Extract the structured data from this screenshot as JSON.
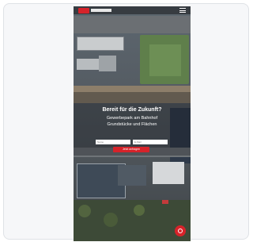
{
  "hero": {
    "headline": "Bereit für die Zukunft?",
    "subline_1": "Gewerbepark am Bahnhof",
    "subline_2": "Grundstücke und Flächen"
  },
  "form": {
    "field_1_placeholder": "Name",
    "field_2_placeholder": "E-Mail"
  },
  "cta": {
    "label": "Jetzt anfragen"
  },
  "colors": {
    "accent": "#d6232a",
    "card_bg": "#f6f7f9",
    "card_border": "#dfe2e6"
  },
  "icons": {
    "menu": "menu-icon",
    "fab": "chat-icon",
    "logo": "logo-icon"
  }
}
